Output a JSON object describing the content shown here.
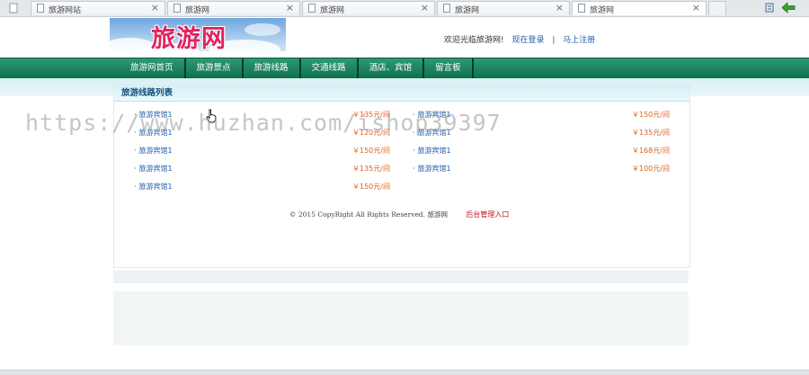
{
  "browser": {
    "tabs": [
      {
        "title": "旅游网站"
      },
      {
        "title": "旅游网"
      },
      {
        "title": "旅游网"
      },
      {
        "title": "旅游网"
      },
      {
        "title": "旅游网"
      }
    ],
    "close_glyph": "×"
  },
  "header": {
    "logo_text": "旅游网",
    "welcome": "欢迎光临旅游网!",
    "login_link": "现在登录",
    "separator": "|",
    "register_link": "马上注册"
  },
  "nav": {
    "items": [
      "旅游网首页",
      "旅游景点",
      "旅游线路",
      "交通线路",
      "酒店、宾馆",
      "留言板"
    ]
  },
  "route_list": {
    "title": "旅游线路列表",
    "left_column": [
      {
        "name": "旅游宾馆1",
        "price": "￥135元/间"
      },
      {
        "name": "旅游宾馆1",
        "price": "￥120元/间"
      },
      {
        "name": "旅游宾馆1",
        "price": "￥150元/间"
      },
      {
        "name": "旅游宾馆1",
        "price": "￥135元/间"
      },
      {
        "name": "旅游宾馆1",
        "price": "￥150元/间"
      }
    ],
    "right_column": [
      {
        "name": "旅游宾馆1",
        "price": "￥150元/间"
      },
      {
        "name": "旅游宾馆1",
        "price": "￥135元/间"
      },
      {
        "name": "旅游宾馆1",
        "price": "￥168元/间"
      },
      {
        "name": "旅游宾馆1",
        "price": "￥100元/间"
      }
    ]
  },
  "footer": {
    "copyright": "© 2015 CopyRight  All Rights Reserved. 旅游网",
    "admin_link": "后台管理入口"
  },
  "watermark": "https://www.huzhan.com/ishop39397"
}
